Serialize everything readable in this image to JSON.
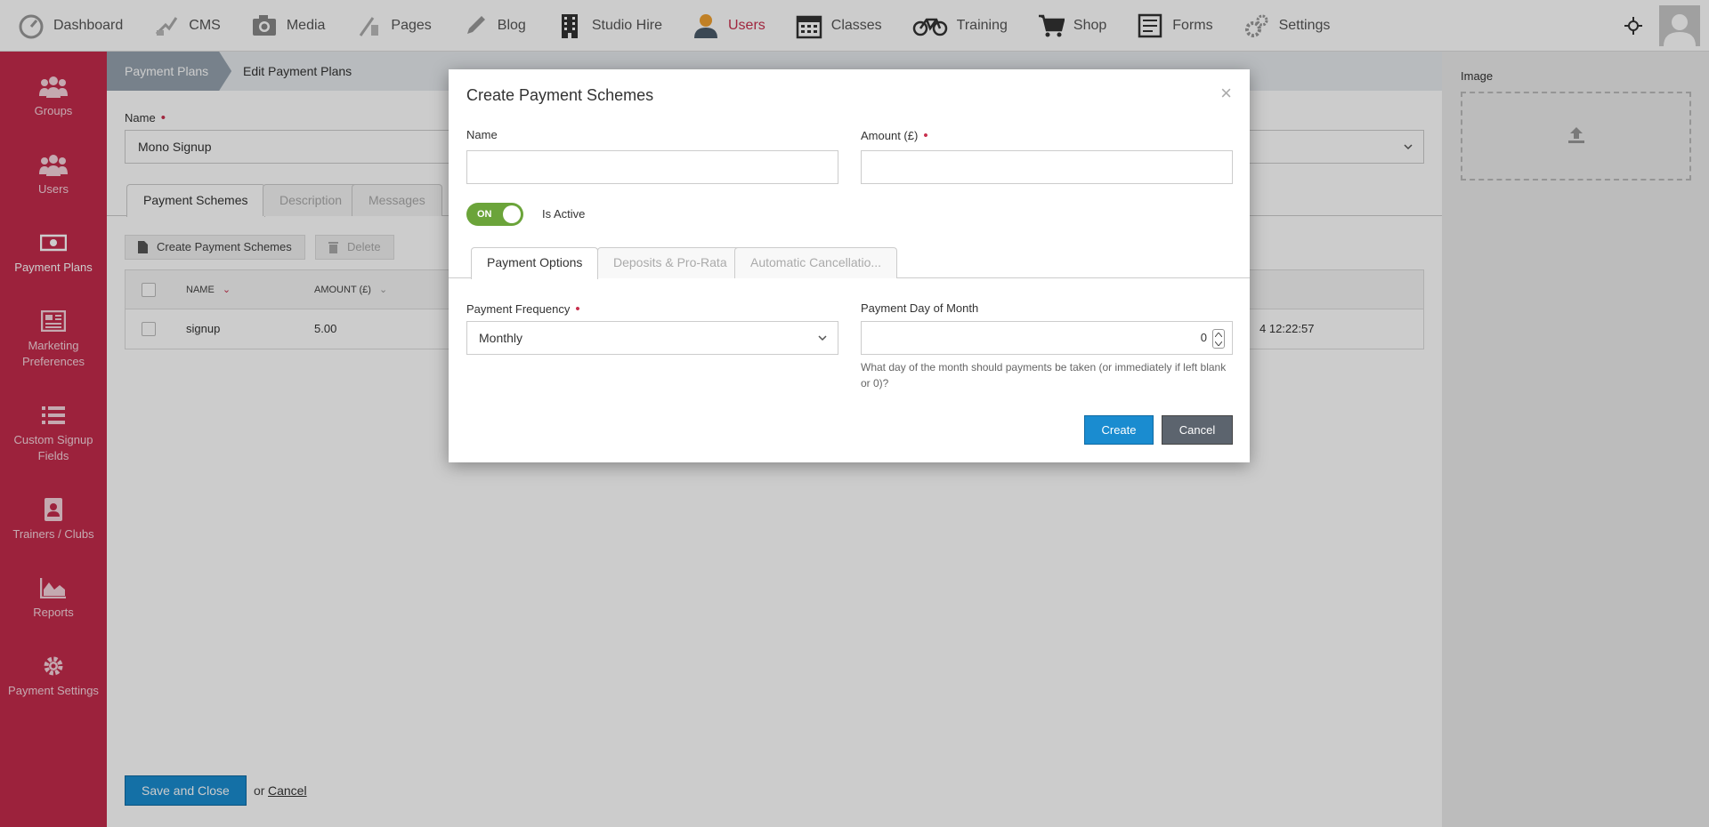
{
  "nav": {
    "items": [
      {
        "label": "Dashboard",
        "icon": "dashboard-icon"
      },
      {
        "label": "CMS",
        "icon": "cms-icon"
      },
      {
        "label": "Media",
        "icon": "camera-icon"
      },
      {
        "label": "Pages",
        "icon": "pages-icon"
      },
      {
        "label": "Blog",
        "icon": "pencil-icon"
      },
      {
        "label": "Studio Hire",
        "icon": "building-icon"
      },
      {
        "label": "Users",
        "icon": "user-icon"
      },
      {
        "label": "Classes",
        "icon": "calendar-icon"
      },
      {
        "label": "Training",
        "icon": "bicycle-icon"
      },
      {
        "label": "Shop",
        "icon": "cart-icon"
      },
      {
        "label": "Forms",
        "icon": "form-icon"
      },
      {
        "label": "Settings",
        "icon": "gears-icon"
      }
    ],
    "active_item": "Users"
  },
  "sidebar": {
    "items": [
      {
        "label": "Groups",
        "icon": "group-icon"
      },
      {
        "label": "Users",
        "icon": "users-icon"
      },
      {
        "label": "Payment Plans",
        "icon": "money-icon"
      },
      {
        "label": "Marketing Preferences",
        "icon": "newspaper-icon"
      },
      {
        "label": "Custom Signup Fields",
        "icon": "list-icon"
      },
      {
        "label": "Trainers / Clubs",
        "icon": "contact-book-icon"
      },
      {
        "label": "Reports",
        "icon": "area-chart-icon"
      },
      {
        "label": "Payment Settings",
        "icon": "gear-icon"
      }
    ],
    "active_item": "Payment Plans"
  },
  "breadcrumb": {
    "first": "Payment Plans",
    "second": "Edit Payment Plans"
  },
  "form": {
    "name_label": "Name",
    "name_value": "Mono Signup"
  },
  "page_tabs": [
    "Payment Schemes",
    "Description",
    "Messages"
  ],
  "toolbar": {
    "create": "Create Payment Schemes",
    "delete": "Delete"
  },
  "grid": {
    "columns": [
      "NAME",
      "AMOUNT (£)"
    ],
    "rows": [
      {
        "name": "signup",
        "amount": "5.00",
        "timestamp": "4 12:22:57"
      }
    ]
  },
  "footer": {
    "save": "Save and Close",
    "or": "or",
    "cancel": "Cancel"
  },
  "right_panel": {
    "image_label": "Image"
  },
  "modal": {
    "title": "Create Payment Schemes",
    "name_label": "Name",
    "name_value": "",
    "amount_label": "Amount (£)",
    "amount_value": "",
    "toggle_label": "ON",
    "is_active_label": "Is Active",
    "tabs": [
      "Payment Options",
      "Deposits & Pro-Rata",
      "Automatic Cancellatio..."
    ],
    "frequency_label": "Payment Frequency",
    "frequency_value": "Monthly",
    "day_label": "Payment Day of Month",
    "day_value": "0",
    "day_help": "What day of the month should payments be taken (or immediately if left blank or 0)?",
    "create_button": "Create",
    "cancel_button": "Cancel",
    "close_symbol": "×"
  },
  "colors": {
    "sidebar": "#c42b4c",
    "accent_active": "#c8304e",
    "primary_button": "#1a8cd0",
    "toggle_on": "#6ba43a"
  }
}
